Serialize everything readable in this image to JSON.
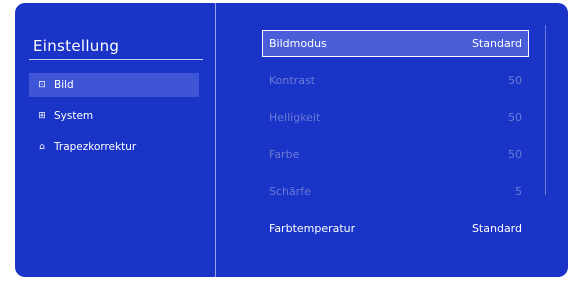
{
  "settings_menu": {
    "title": "Einstellung",
    "items": [
      {
        "label": "Bild",
        "icon": "picture-icon",
        "glyph": "⊡"
      },
      {
        "label": "System",
        "icon": "grid-icon",
        "glyph": "⊞"
      },
      {
        "label": "Trapezkorrektur",
        "icon": "keystone-icon",
        "glyph": "⌂"
      }
    ]
  },
  "picture_settings": {
    "rows": [
      {
        "label": "Bildmodus",
        "value": "Standard"
      },
      {
        "label": "Kontrast",
        "value": "50"
      },
      {
        "label": "Helligkeit",
        "value": "50"
      },
      {
        "label": "Farbe",
        "value": "50"
      },
      {
        "label": "Schärfe",
        "value": "5"
      },
      {
        "label": "Farbtemperatur",
        "value": "Standard"
      }
    ]
  },
  "colors": {
    "background": "#1b34c8",
    "highlight": "#4a5ed9",
    "disabled_text": "#6a7bd6"
  }
}
